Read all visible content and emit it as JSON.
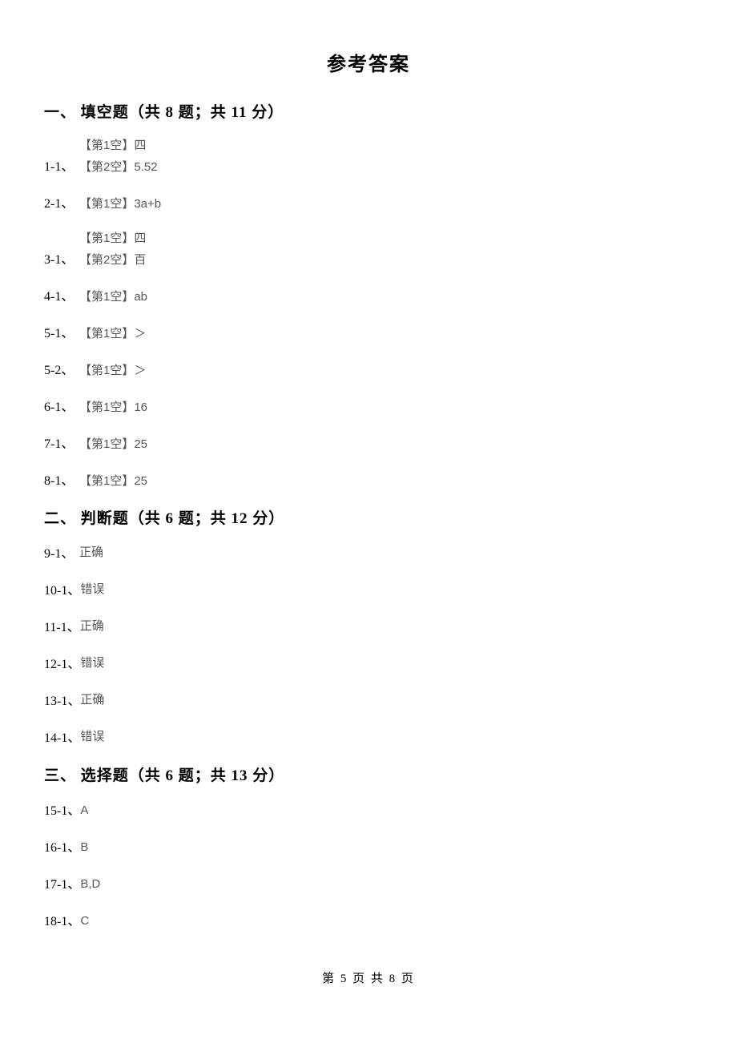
{
  "title": "参考答案",
  "sections": [
    {
      "heading": "一、 填空题（共 8 题；共 11 分）",
      "items": [
        {
          "num": "1-1、",
          "blanks": [
            "【第1空】四",
            "【第2空】5.52"
          ]
        },
        {
          "num": "2-1、",
          "blanks": [
            "【第1空】3a+b"
          ]
        },
        {
          "num": "3-1、",
          "blanks": [
            "【第1空】四",
            "【第2空】百"
          ]
        },
        {
          "num": "4-1、",
          "blanks": [
            "【第1空】ab"
          ]
        },
        {
          "num": "5-1、",
          "blanks": [
            "【第1空】＞"
          ]
        },
        {
          "num": "5-2、",
          "blanks": [
            "【第1空】＞"
          ]
        },
        {
          "num": "6-1、",
          "blanks": [
            "【第1空】16"
          ]
        },
        {
          "num": "7-1、",
          "blanks": [
            "【第1空】25"
          ]
        },
        {
          "num": "8-1、",
          "blanks": [
            "【第1空】25"
          ]
        }
      ]
    },
    {
      "heading": "二、 判断题（共 6 题；共 12 分）",
      "items": [
        {
          "num": "9-1、",
          "ans": "正确"
        },
        {
          "num": "10-1、",
          "ans": "错误"
        },
        {
          "num": "11-1、",
          "ans": "正确"
        },
        {
          "num": "12-1、",
          "ans": "错误"
        },
        {
          "num": "13-1、",
          "ans": "正确"
        },
        {
          "num": "14-1、",
          "ans": "错误"
        }
      ]
    },
    {
      "heading": "三、 选择题（共 6 题；共 13 分）",
      "items": [
        {
          "num": "15-1、",
          "ans": "A"
        },
        {
          "num": "16-1、",
          "ans": "B"
        },
        {
          "num": "17-1、",
          "ans": "B,D"
        },
        {
          "num": "18-1、",
          "ans": "C"
        }
      ]
    }
  ],
  "footer": "第 5 页 共 8 页"
}
